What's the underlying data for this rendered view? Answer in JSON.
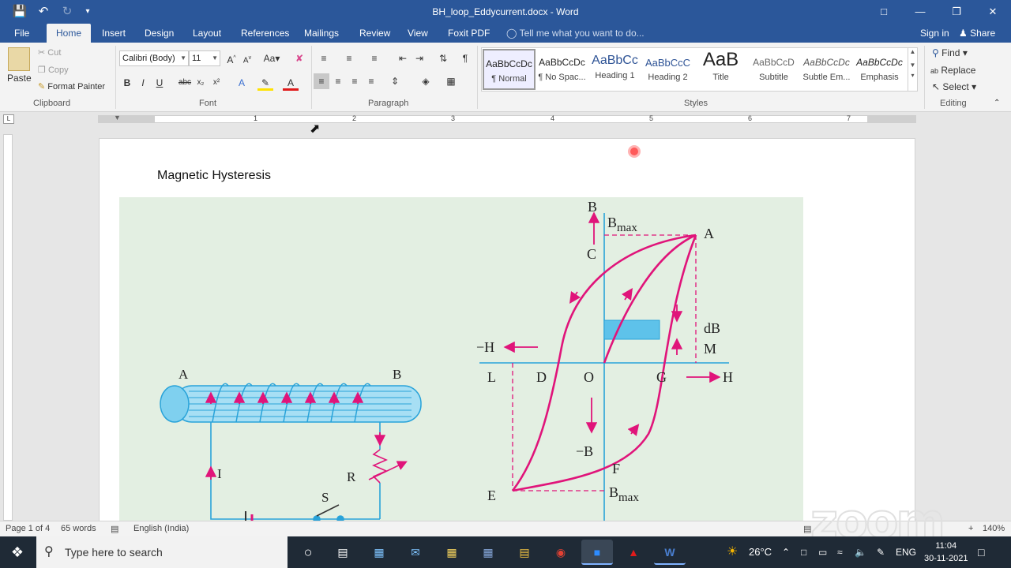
{
  "window": {
    "title": "BH_loop_Eddycurrent.docx - Word"
  },
  "qat": {
    "save": "save-icon",
    "undo": "undo-icon",
    "redo": "redo-icon",
    "customize": "customize-icon"
  },
  "tabs": [
    {
      "label": "File"
    },
    {
      "label": "Home"
    },
    {
      "label": "Insert"
    },
    {
      "label": "Design"
    },
    {
      "label": "Layout"
    },
    {
      "label": "References"
    },
    {
      "label": "Mailings"
    },
    {
      "label": "Review"
    },
    {
      "label": "View"
    },
    {
      "label": "Foxit PDF"
    }
  ],
  "tellme": "Tell me what you want to do...",
  "account": {
    "signin": "Sign in",
    "share": "Share"
  },
  "clipboard": {
    "paste": "Paste",
    "cut": "Cut",
    "copy": "Copy",
    "format_painter": "Format Painter",
    "label": "Clipboard"
  },
  "font": {
    "name": "Calibri (Body)",
    "size": "11",
    "label": "Font",
    "bold": "B",
    "italic": "I",
    "underline": "U",
    "strike": "abc",
    "sub": "x₂",
    "sup": "x²",
    "case": "Aa"
  },
  "paragraph": {
    "label": "Paragraph",
    "pilcrow": "¶"
  },
  "styles": {
    "label": "Styles",
    "items": [
      {
        "preview": "AaBbCcDc",
        "name": "¶ Normal"
      },
      {
        "preview": "AaBbCcDc",
        "name": "¶ No Spac..."
      },
      {
        "preview": "AaBbCc",
        "name": "Heading 1"
      },
      {
        "preview": "AaBbCcC",
        "name": "Heading 2"
      },
      {
        "preview": "AaB",
        "name": "Title"
      },
      {
        "preview": "AaBbCcD",
        "name": "Subtitle"
      },
      {
        "preview": "AaBbCcDc",
        "name": "Subtle Em..."
      },
      {
        "preview": "AaBbCcDc",
        "name": "Emphasis"
      }
    ]
  },
  "editing": {
    "find": "Find",
    "replace": "Replace",
    "select": "Select",
    "label": "Editing"
  },
  "ruler": {
    "numbers": [
      "1",
      "2",
      "3",
      "4",
      "5",
      "6",
      "7"
    ]
  },
  "document": {
    "heading": "Magnetic Hysteresis",
    "figure_labels": {
      "A_left": "A",
      "B_right": "B",
      "I": "I",
      "R": "R",
      "S": "S",
      "B_axis": "B",
      "Bmax_top": "B",
      "max": "max",
      "A_loop": "A",
      "C": "C",
      "dB": "dB",
      "M": "M",
      "minusH": "−H",
      "L": "L",
      "D": "D",
      "O": "O",
      "G": "G",
      "H": "H",
      "minusB": "−B",
      "F": "F",
      "E": "E",
      "Bmax_bottom": "B"
    }
  },
  "status": {
    "page": "Page 1 of 4",
    "words": "65 words",
    "language": "English (India)",
    "zoom": "140%"
  },
  "taskbar": {
    "search": "Type here to search",
    "temperature": "26°C",
    "lang": "ENG",
    "time": "11:04",
    "date": "30-11-2021"
  },
  "colors": {
    "word_blue": "#2b579a",
    "loop_pink": "#e0147a",
    "axis_blue": "#29a3d9",
    "figure_bg": "#e3efe2"
  }
}
